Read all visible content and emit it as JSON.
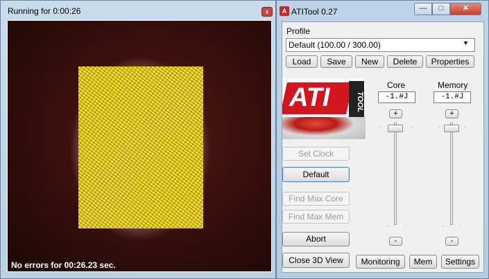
{
  "render_window": {
    "title": "Running for 0:00:26",
    "close_glyph": "x",
    "status_text": "No errors for 00:26.23 sec."
  },
  "ati_window": {
    "title": "ATITool 0.27",
    "app_icon": "ati-icon",
    "caption_buttons": {
      "minimize": "—",
      "maximize": "□",
      "close": "✕"
    },
    "profile_label": "Profile",
    "profile_value": "Default (100.00 / 300.00)",
    "profile_buttons": [
      "Load",
      "Save",
      "New",
      "Delete",
      "Properties"
    ],
    "logo": {
      "text": "ATI",
      "side": "TOOL"
    },
    "core": {
      "label": "Core",
      "value": "-1.#J",
      "plus": "+",
      "minus": "-"
    },
    "memory": {
      "label": "Memory",
      "value": "-1.#J",
      "plus": "+",
      "minus": "-"
    },
    "actions": {
      "set_clock": "Set Clock",
      "default": "Default",
      "find_max_core": "Find Max Core",
      "find_max_mem": "Find Max Mem",
      "abort": "Abort",
      "close_3d_view": "Close 3D View"
    },
    "bottom_buttons": {
      "monitoring": "Monitoring",
      "mem": "Mem",
      "settings": "Settings"
    }
  },
  "colors": {
    "accent_red": "#d2161e",
    "highlight_yellow": "#f0e21a"
  }
}
